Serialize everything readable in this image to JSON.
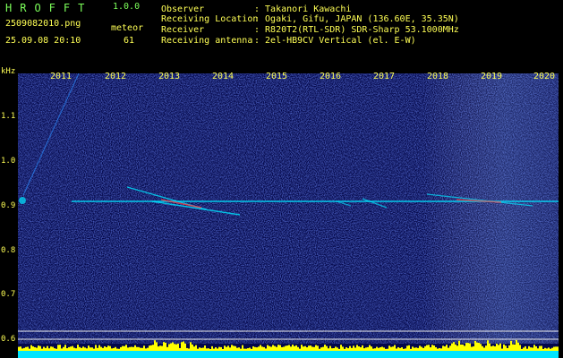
{
  "header": {
    "app_name": "HROFFT",
    "version": "1.0.0",
    "filename": "2509082010.png",
    "timestamp": "25.09.08 20:10",
    "meteor_label": "meteor",
    "meteor_count": "61"
  },
  "info": [
    {
      "label": "Observer",
      "value": ": Takanori Kawachi"
    },
    {
      "label": "Receiving Location",
      "value": ": Ogaki, Gifu, JAPAN (136.60E, 35.35N)"
    },
    {
      "label": "Receiver",
      "value": ": R820T2(RTL-SDR) SDR-Sharp 53.1000MHz"
    },
    {
      "label": "Receiving antenna",
      "value": ": 2el-HB9CV Vertical (el. E-W)"
    }
  ],
  "axis": {
    "y_unit": "kHz",
    "y_ticks": [
      "1.1",
      "1.0",
      "0.9",
      "0.8",
      "0.7",
      "0.6"
    ],
    "x_ticks": [
      "2011",
      "2012",
      "2013",
      "2014",
      "2015",
      "2016",
      "2017",
      "2018",
      "2019",
      "2020"
    ]
  },
  "colors": {
    "text": "#ffff55",
    "title": "#7cff5a",
    "background": "#04084a",
    "carrier": "#00e5ff",
    "strip_base": "#00e5ff",
    "strip_noise": "#ffff00"
  }
}
